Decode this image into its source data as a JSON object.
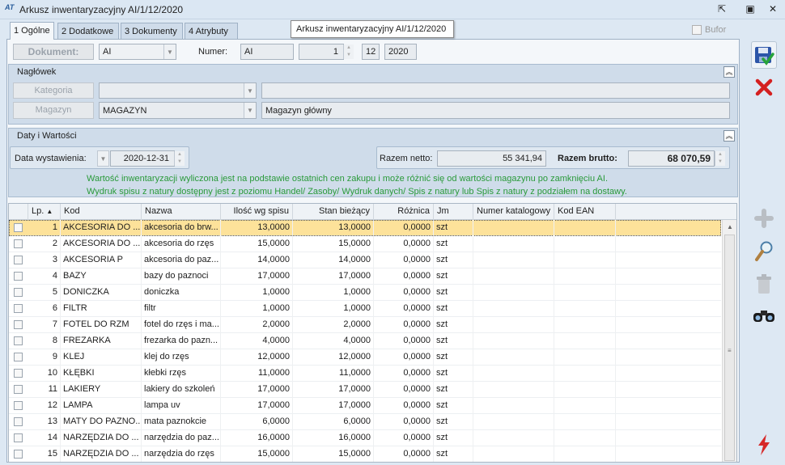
{
  "window": {
    "title": "Arkusz inwentaryzacyjny AI/1/12/2020",
    "app_icon_text": "AT",
    "buttons": [
      "⇱",
      "▣",
      "✕"
    ]
  },
  "tabs": [
    {
      "label": "1 Ogólne",
      "active": true
    },
    {
      "label": "2 Dodatkowe",
      "active": false
    },
    {
      "label": "3 Dokumenty",
      "active": false
    },
    {
      "label": "4 Atrybuty",
      "active": false
    }
  ],
  "tooltip": "Arkusz inwentaryzacyjny AI/1/12/2020",
  "bufor_label": "Bufor",
  "dokument": {
    "button": "Dokument:",
    "type": "AI",
    "numer_label": "Numer:",
    "numer_prefix": "AI",
    "numer_value": "1",
    "month": "12",
    "year": "2020"
  },
  "naglowek": {
    "title": "Nagłówek",
    "kategoria_button": "Kategoria",
    "kategoria_value": "",
    "kategoria_desc": "",
    "magazyn_button": "Magazyn",
    "magazyn_value": "MAGAZYN",
    "magazyn_desc": "Magazyn główny"
  },
  "daty": {
    "title": "Daty i Wartości",
    "data_label": "Data wystawienia:",
    "data_value": "2020-12-31",
    "netto_label": "Razem netto:",
    "netto_value": "55 341,94",
    "brutto_label": "Razem brutto:",
    "brutto_value": "68 070,59",
    "info_line1": "Wartość inwentaryzacji wyliczona jest na podstawie ostatnich cen zakupu i może różnić się od wartości magazynu po zamknięciu AI.",
    "info_line2": "Wydruk spisu z natury dostępny jest z poziomu Handel/ Zasoby/ Wydruk danych/ Spis z natury lub Spis z natury z podziałem na dostawy.",
    "info_color": "#2a9a3a"
  },
  "table": {
    "columns": [
      "Lp.",
      "Kod",
      "Nazwa",
      "Ilość wg spisu",
      "Stan bieżący",
      "Różnica",
      "Jm",
      "Numer katalogowy",
      "Kod EAN"
    ],
    "rows": [
      [
        "1",
        "AKCESORIA DO ...",
        "akcesoria do brw...",
        "13,0000",
        "13,0000",
        "0,0000",
        "szt",
        "",
        ""
      ],
      [
        "2",
        "AKCESORIA DO ...",
        "akcesoria do rzęs",
        "15,0000",
        "15,0000",
        "0,0000",
        "szt",
        "",
        ""
      ],
      [
        "3",
        "AKCESORIA P",
        "akcesoria do paz...",
        "14,0000",
        "14,0000",
        "0,0000",
        "szt",
        "",
        ""
      ],
      [
        "4",
        "BAZY",
        "bazy do paznoci",
        "17,0000",
        "17,0000",
        "0,0000",
        "szt",
        "",
        ""
      ],
      [
        "5",
        "DONICZKA",
        "doniczka",
        "1,0000",
        "1,0000",
        "0,0000",
        "szt",
        "",
        ""
      ],
      [
        "6",
        "FILTR",
        "filtr",
        "1,0000",
        "1,0000",
        "0,0000",
        "szt",
        "",
        ""
      ],
      [
        "7",
        "FOTEL DO RZM",
        "fotel do rzęs i ma...",
        "2,0000",
        "2,0000",
        "0,0000",
        "szt",
        "",
        ""
      ],
      [
        "8",
        "FREZARKA",
        "frezarka do pazn...",
        "4,0000",
        "4,0000",
        "0,0000",
        "szt",
        "",
        ""
      ],
      [
        "9",
        "KLEJ",
        "klej do rzęs",
        "12,0000",
        "12,0000",
        "0,0000",
        "szt",
        "",
        ""
      ],
      [
        "10",
        "KŁĘBKI",
        "kłebki rzęs",
        "11,0000",
        "11,0000",
        "0,0000",
        "szt",
        "",
        ""
      ],
      [
        "11",
        "LAKIERY",
        "lakiery do szkoleń",
        "17,0000",
        "17,0000",
        "0,0000",
        "szt",
        "",
        ""
      ],
      [
        "12",
        "LAMPA",
        "lampa uv",
        "17,0000",
        "17,0000",
        "0,0000",
        "szt",
        "",
        ""
      ],
      [
        "13",
        "MATY DO PAZNO...",
        "mata paznokcie",
        "6,0000",
        "6,0000",
        "0,0000",
        "szt",
        "",
        ""
      ],
      [
        "14",
        "NARZĘDZIA DO ...",
        "narzędzia do paz...",
        "16,0000",
        "16,0000",
        "0,0000",
        "szt",
        "",
        ""
      ],
      [
        "15",
        "NARZĘDZIA DO ...",
        "narzędzia do rzęs",
        "15,0000",
        "15,0000",
        "0,0000",
        "szt",
        "",
        ""
      ]
    ]
  },
  "toolbar": {
    "save_icon": "save-icon",
    "cancel_icon": "cancel-icon",
    "add_icon": "add-icon",
    "edit_icon": "magnifier-icon",
    "delete_icon": "trash-icon",
    "preview_icon": "binoculars-icon",
    "bolt_icon": "lightning-icon"
  }
}
